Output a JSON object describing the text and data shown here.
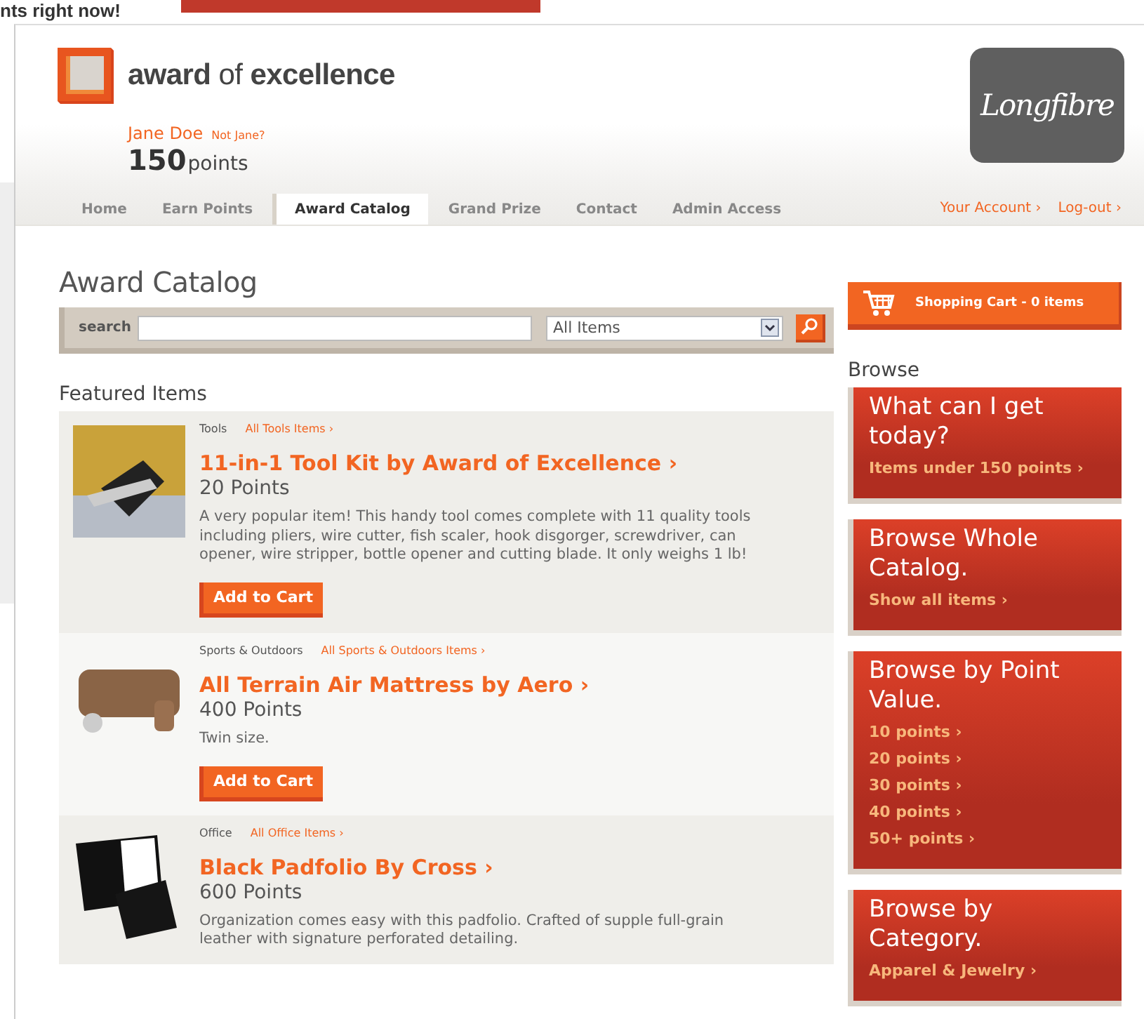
{
  "background_page": {
    "headline": "nts right now!"
  },
  "brand": {
    "name": "**award** of **excellence**"
  },
  "user": {
    "name": "Jane Doe",
    "switch_link": "Not Jane?",
    "points_value": "150",
    "points_unit": "points"
  },
  "partner_logo": {
    "text": "Longfibre"
  },
  "nav": {
    "tabs": [
      {
        "label": "Home",
        "selected": false
      },
      {
        "label": "Earn Points",
        "selected": false
      },
      {
        "label": "Award Catalog",
        "selected": true
      },
      {
        "label": "Grand Prize",
        "selected": false
      },
      {
        "label": "Contact",
        "selected": false
      },
      {
        "label": "Admin Access",
        "selected": false
      }
    ],
    "account_links": [
      "Your Account ›",
      "Log-out ›"
    ]
  },
  "page_title": "Award Catalog",
  "search": {
    "label": "search",
    "category_select": "All Items"
  },
  "cart": {
    "label": "Shopping Cart - 0 items"
  },
  "featured": {
    "heading": "Featured Items",
    "items": [
      {
        "category": "Tools",
        "category_link": "All Tools Items ›",
        "title": "11-in-1 Tool Kit by Award of Excellence ›",
        "points": "20 Points",
        "description": "A very popular item! This handy tool comes complete with 11 quality tools including pliers, wire cutter, fish scaler, hook disgorger, screwdriver, can opener, wire stripper, bottle opener and cutting blade. It only weighs 1 lb!",
        "button": "Add to Cart"
      },
      {
        "category": "Sports & Outdoors",
        "category_link": "All Sports & Outdoors Items ›",
        "title": "All Terrain Air Mattress by Aero ›",
        "points": "400 Points",
        "description": "Twin size.",
        "button": "Add to Cart"
      },
      {
        "category": "Office",
        "category_link": "All Office Items ›",
        "title": "Black Padfolio By Cross ›",
        "points": "600 Points",
        "description": "Organization comes easy with this padfolio. Crafted of supple full-grain leather with signature perforated detailing."
      }
    ]
  },
  "browse": {
    "heading": "Browse",
    "panels": [
      {
        "title": "What can I get today?",
        "links": [
          "Items under 150 points ›"
        ]
      },
      {
        "title": "Browse Whole Catalog.",
        "links": [
          "Show all items ›"
        ]
      },
      {
        "title": "Browse by Point Value.",
        "links": [
          "10 points ›",
          "20 points ›",
          "30 points ›",
          "40 points ›",
          "50+ points ›"
        ]
      },
      {
        "title": "Browse by Category.",
        "links": [
          "Apparel & Jewelry ›"
        ]
      }
    ]
  }
}
